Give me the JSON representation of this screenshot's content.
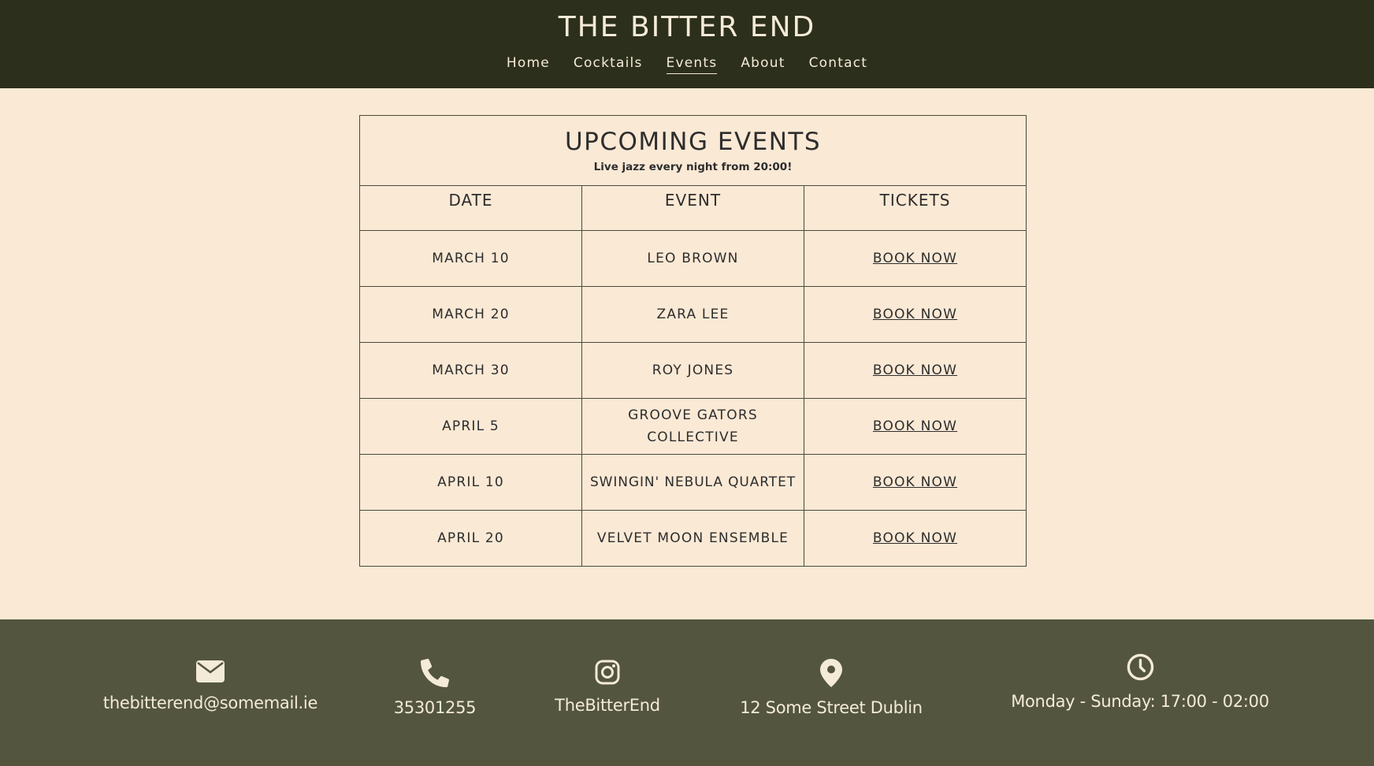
{
  "header": {
    "title": "THE BITTER END",
    "nav": [
      "Home",
      "Cocktails",
      "Events",
      "About",
      "Contact"
    ],
    "active_nav": "Events"
  },
  "events": {
    "title": "UPCOMING EVENTS",
    "subtitle": "Live jazz every night from 20:00!",
    "columns": [
      "DATE",
      "EVENT",
      "TICKETS"
    ],
    "rows": [
      {
        "date": "MARCH 10",
        "event": "LEO BROWN",
        "tickets": "BOOK NOW"
      },
      {
        "date": "MARCH 20",
        "event": "ZARA LEE",
        "tickets": "BOOK NOW"
      },
      {
        "date": "MARCH 30",
        "event": "ROY JONES",
        "tickets": "BOOK NOW"
      },
      {
        "date": "APRIL 5",
        "event": "GROOVE GATORS COLLECTIVE",
        "tickets": "BOOK NOW"
      },
      {
        "date": "APRIL 10",
        "event": "SWINGIN' NEBULA QUARTET",
        "tickets": "BOOK NOW"
      },
      {
        "date": "APRIL 20",
        "event": "VELVET MOON ENSEMBLE",
        "tickets": "BOOK NOW"
      }
    ]
  },
  "footer": {
    "email": {
      "icon": "envelope-icon",
      "text": "thebitterend@somemail.ie"
    },
    "phone": {
      "icon": "phone-icon",
      "text": "35301255"
    },
    "instagram": {
      "icon": "instagram-icon",
      "text": "TheBitterEnd"
    },
    "address": {
      "icon": "map-pin-icon",
      "text": "12 Some Street Dublin"
    },
    "hours": {
      "icon": "clock-icon",
      "text": "Monday - Sunday: 17:00 - 02:00"
    }
  },
  "colors": {
    "header_bg": "#2c2f1b",
    "page_bg": "#fae9d5",
    "footer_bg": "#53553f",
    "light_text": "#f4ead8",
    "dark_text": "#2d2d2d"
  }
}
